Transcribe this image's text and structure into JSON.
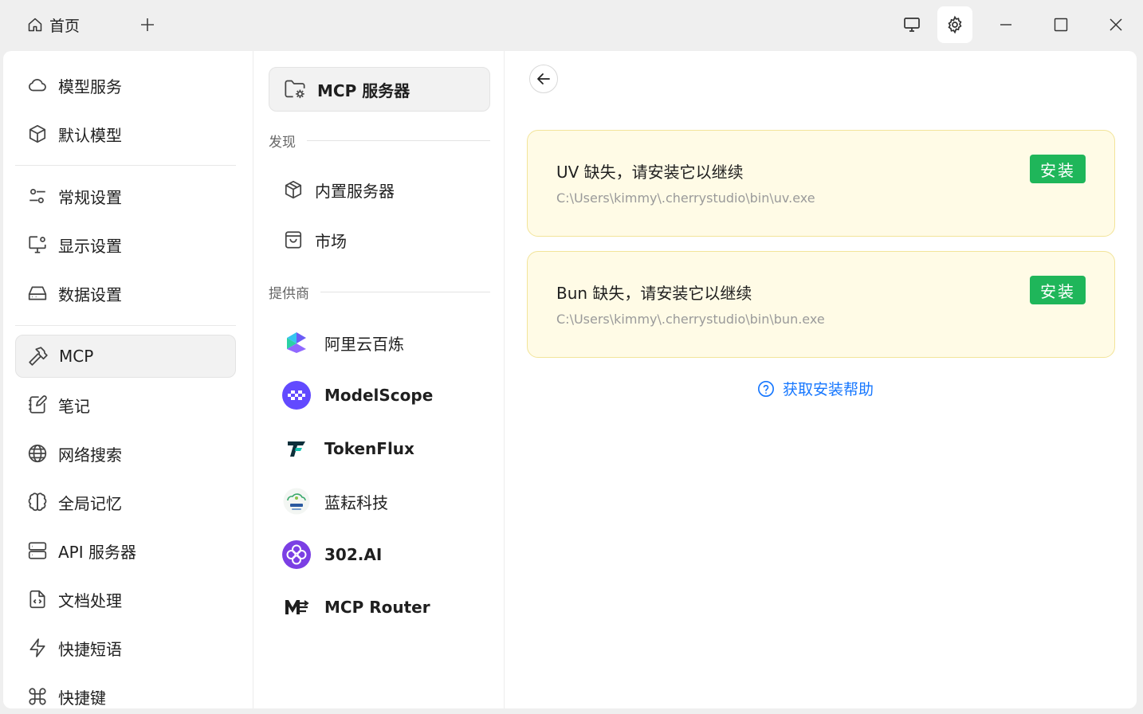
{
  "titlebar": {
    "home_tab_label": "首页"
  },
  "nav": {
    "items": [
      {
        "label": "模型服务"
      },
      {
        "label": "默认模型"
      },
      {
        "label": "常规设置"
      },
      {
        "label": "显示设置"
      },
      {
        "label": "数据设置"
      },
      {
        "label": "MCP"
      },
      {
        "label": "笔记"
      },
      {
        "label": "网络搜索"
      },
      {
        "label": "全局记忆"
      },
      {
        "label": "API 服务器"
      },
      {
        "label": "文档处理"
      },
      {
        "label": "快捷短语"
      },
      {
        "label": "快捷键"
      }
    ]
  },
  "mid": {
    "header": "MCP 服务器",
    "discover_label": "发现",
    "discover_items": [
      {
        "label": "内置服务器"
      },
      {
        "label": "市场"
      }
    ],
    "providers_label": "提供商",
    "providers": [
      {
        "label": "阿里云百炼"
      },
      {
        "label": "ModelScope"
      },
      {
        "label": "TokenFlux"
      },
      {
        "label": "蓝耘科技"
      },
      {
        "label": "302.AI"
      },
      {
        "label": "MCP Router"
      }
    ]
  },
  "content": {
    "warnings": [
      {
        "title": "UV 缺失，请安装它以继续",
        "path": "C:\\Users\\kimmy\\.cherrystudio\\bin\\uv.exe",
        "button": "安装"
      },
      {
        "title": "Bun 缺失，请安装它以继续",
        "path": "C:\\Users\\kimmy\\.cherrystudio\\bin\\bun.exe",
        "button": "安装"
      }
    ],
    "help_link": "获取安装帮助"
  },
  "colors": {
    "accent_green": "#1fb65a",
    "link_blue": "#1677ff",
    "warn_bg": "#fffbe6"
  }
}
